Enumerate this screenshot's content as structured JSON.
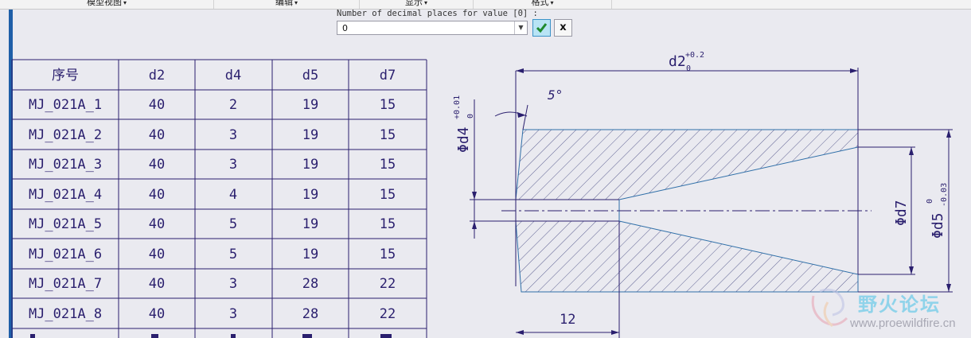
{
  "menubar": {
    "items": [
      {
        "label": "模型视图"
      },
      {
        "label": "编辑"
      },
      {
        "label": "显示"
      },
      {
        "label": "格式"
      }
    ]
  },
  "dialog": {
    "prompt": "Number of decimal places for value [0] :",
    "value": "0"
  },
  "table": {
    "headers": [
      "序号",
      "d2",
      "d4",
      "d5",
      "d7"
    ],
    "rows": [
      [
        "MJ_021A_1",
        "40",
        "2",
        "19",
        "15"
      ],
      [
        "MJ_021A_2",
        "40",
        "3",
        "19",
        "15"
      ],
      [
        "MJ_021A_3",
        "40",
        "3",
        "19",
        "15"
      ],
      [
        "MJ_021A_4",
        "40",
        "4",
        "19",
        "15"
      ],
      [
        "MJ_021A_5",
        "40",
        "5",
        "19",
        "15"
      ],
      [
        "MJ_021A_6",
        "40",
        "5",
        "19",
        "15"
      ],
      [
        "MJ_021A_7",
        "40",
        "3",
        "28",
        "22"
      ],
      [
        "MJ_021A_8",
        "40",
        "3",
        "28",
        "22"
      ]
    ]
  },
  "dimensions": {
    "d2": {
      "main": "d2",
      "upper": "+0.2",
      "lower": "0"
    },
    "angle": "5°",
    "d4": {
      "main": "Φd4",
      "upper": "+0.01",
      "lower": "0"
    },
    "d7": {
      "main": "Φd7"
    },
    "d5": {
      "main": "Φd5",
      "upper": "0",
      "lower": "-0.03"
    },
    "length": "12"
  },
  "watermark": {
    "title": "野火论坛",
    "url": "www.proewildfire.cn"
  },
  "colors": {
    "line": "#2a1f6e",
    "hatch": "#3a3d7a",
    "accent": "#1f5fa8",
    "outline": "#2f6fa8"
  }
}
